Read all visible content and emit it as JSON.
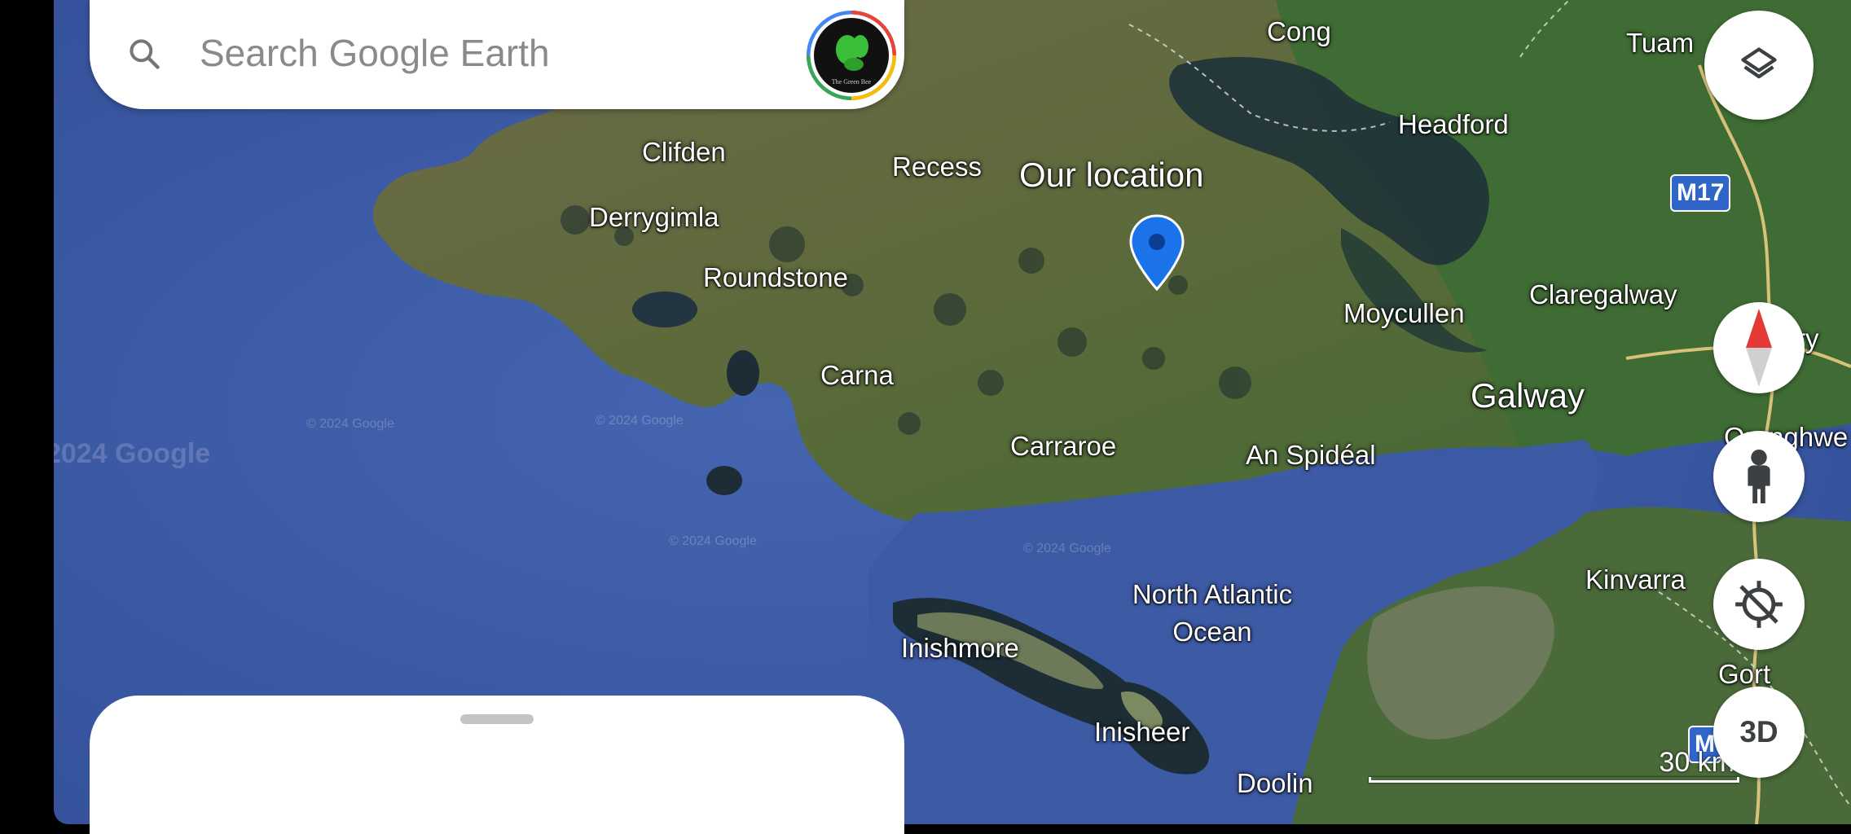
{
  "search": {
    "placeholder": "Search Google Earth",
    "avatar_caption": "The Green Bee"
  },
  "places": [
    {
      "name": "Cong",
      "kind": "town"
    },
    {
      "name": "Tuam",
      "kind": "town"
    },
    {
      "name": "Headford",
      "kind": "town"
    },
    {
      "name": "Clifden",
      "kind": "town"
    },
    {
      "name": "Recess",
      "kind": "town"
    },
    {
      "name": "Derrygimla",
      "kind": "town"
    },
    {
      "name": "Roundstone",
      "kind": "town"
    },
    {
      "name": "Moycullen",
      "kind": "town"
    },
    {
      "name": "Claregalway",
      "kind": "town"
    },
    {
      "name": "Carna",
      "kind": "town"
    },
    {
      "name": "Galway",
      "kind": "city"
    },
    {
      "name": "Carraroe",
      "kind": "town"
    },
    {
      "name": "An Spidéal",
      "kind": "town"
    },
    {
      "name": "Kinvarra",
      "kind": "town"
    },
    {
      "name": "Inishmore",
      "kind": "island"
    },
    {
      "name": "Inisheer",
      "kind": "island"
    },
    {
      "name": "Gort",
      "kind": "town"
    },
    {
      "name": "Doolin",
      "kind": "town"
    }
  ],
  "ocean_label": [
    "North Atlantic",
    "Ocean"
  ],
  "marker": {
    "label": "Our location",
    "color": "#1a73e8"
  },
  "partial_labels": {
    "right1": "ry",
    "right2": "Oranghwe"
  },
  "road_signs": {
    "m17": "M17",
    "m_bottom": "M"
  },
  "watermark": {
    "main": "2024 Google",
    "small": "© 2024 Google"
  },
  "controls": {
    "layers_icon": "layers-icon",
    "compass_icon": "compass-icon",
    "pegman_icon": "street-view-pegman-icon",
    "locate_icon": "location-off-icon",
    "three_d_label": "3D"
  },
  "scale": {
    "label": "30 km"
  },
  "colors": {
    "sea": "#3e5aa3",
    "land": "#5b6e3c",
    "accent": "#1a73e8"
  }
}
